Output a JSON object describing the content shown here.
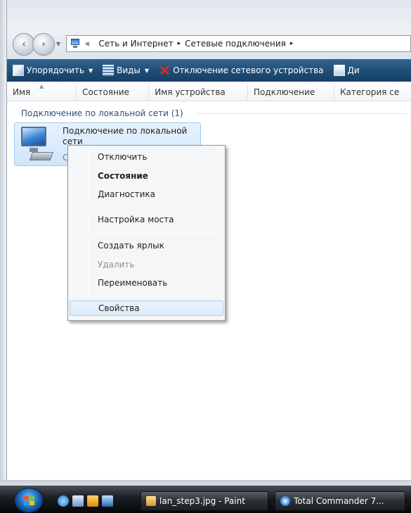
{
  "address_bar": {
    "prefix": "«",
    "crumbs": [
      "Сеть и Интернет",
      "Сетевые подключения"
    ],
    "separator": "▸"
  },
  "toolbar": {
    "organize": "Упорядочить",
    "views": "Виды",
    "disconnect": "Отключение сетевого устройства",
    "diagnose": "Ди"
  },
  "columns": [
    "Имя",
    "Состояние",
    "Имя устройства",
    "Подключение",
    "Категория се"
  ],
  "group": {
    "header": "Подключение по локальной сети (1)"
  },
  "item": {
    "name": "Подключение по локальной сети",
    "status": "С"
  },
  "context_menu": {
    "items": [
      {
        "label": "Отключить",
        "state": "normal"
      },
      {
        "label": "Состояние",
        "state": "default"
      },
      {
        "label": "Диагностика",
        "state": "normal"
      },
      {
        "label": "Настройка моста",
        "state": "normal"
      },
      {
        "label": "Создать ярлык",
        "state": "normal"
      },
      {
        "label": "Удалить",
        "state": "disabled"
      },
      {
        "label": "Переименовать",
        "state": "normal"
      },
      {
        "label": "Свойства",
        "state": "hover"
      }
    ]
  },
  "taskbar": {
    "buttons": [
      "lan_step3.jpg - Paint",
      "Total Commander 7..."
    ]
  },
  "colors": {
    "toolbar_bg": "#1f4f7a",
    "selection_bg": "#cfe6fb",
    "menu_hover_border": "#a8cbef",
    "disconnect_icon": "#e02a1a"
  }
}
